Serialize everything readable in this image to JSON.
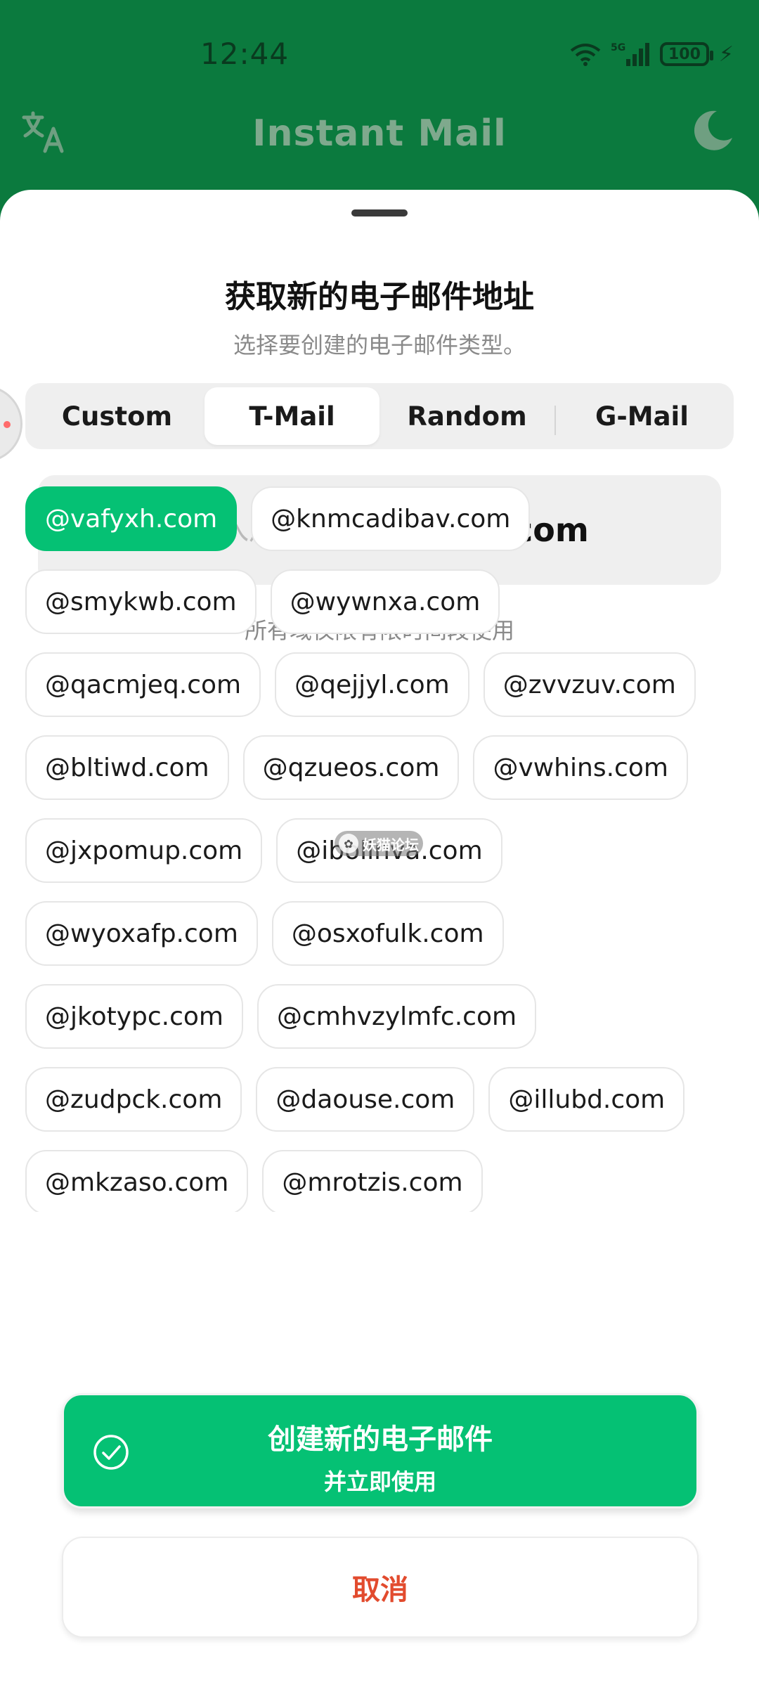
{
  "status_bar": {
    "time": "12:44",
    "network": "5G",
    "battery": "100"
  },
  "app_bar": {
    "title": "Instant Mail",
    "left_icon": "translate-icon",
    "right_icon": "moon-icon"
  },
  "sheet": {
    "title": "获取新的电子邮件地址",
    "subtitle": "选择要创建的电子邮件类型。",
    "tabs": [
      {
        "label": "Custom",
        "active": false
      },
      {
        "label": "T-Mail",
        "active": true
      },
      {
        "label": "Random",
        "active": false
      },
      {
        "label": "G-Mail",
        "active": false
      }
    ],
    "username_placeholder": "输入用户名",
    "selected_domain": "@vafyxh.com",
    "domain_note": "所有域仅限有限时间段使用",
    "domains": [
      "@vafyxh.com",
      "@knmcadibav.com",
      "@smykwb.com",
      "@wywnxa.com",
      "@qacmjeq.com",
      "@qejjyl.com",
      "@zvvzuv.com",
      "@bltiwd.com",
      "@qzueos.com",
      "@vwhins.com",
      "@jxpomup.com",
      "@ibolinva.com",
      "@wyoxafp.com",
      "@osxofulk.com",
      "@jkotypc.com",
      "@cmhvzylmfc.com",
      "@zudpck.com",
      "@daouse.com",
      "@illubd.com",
      "@mkzaso.com",
      "@mrotzis.com"
    ],
    "selected_index": 0,
    "create_button": {
      "label": "创建新的电子邮件",
      "sublabel": "并立即使用",
      "icon": "check-circle-icon"
    },
    "cancel_button": "取消"
  },
  "watermark": {
    "text": "妖猫论坛",
    "icon": "cat-logo-icon"
  },
  "colors": {
    "app_bar": "#0b7a3e",
    "accent": "#05c174",
    "cancel_text": "#e24b2e"
  }
}
